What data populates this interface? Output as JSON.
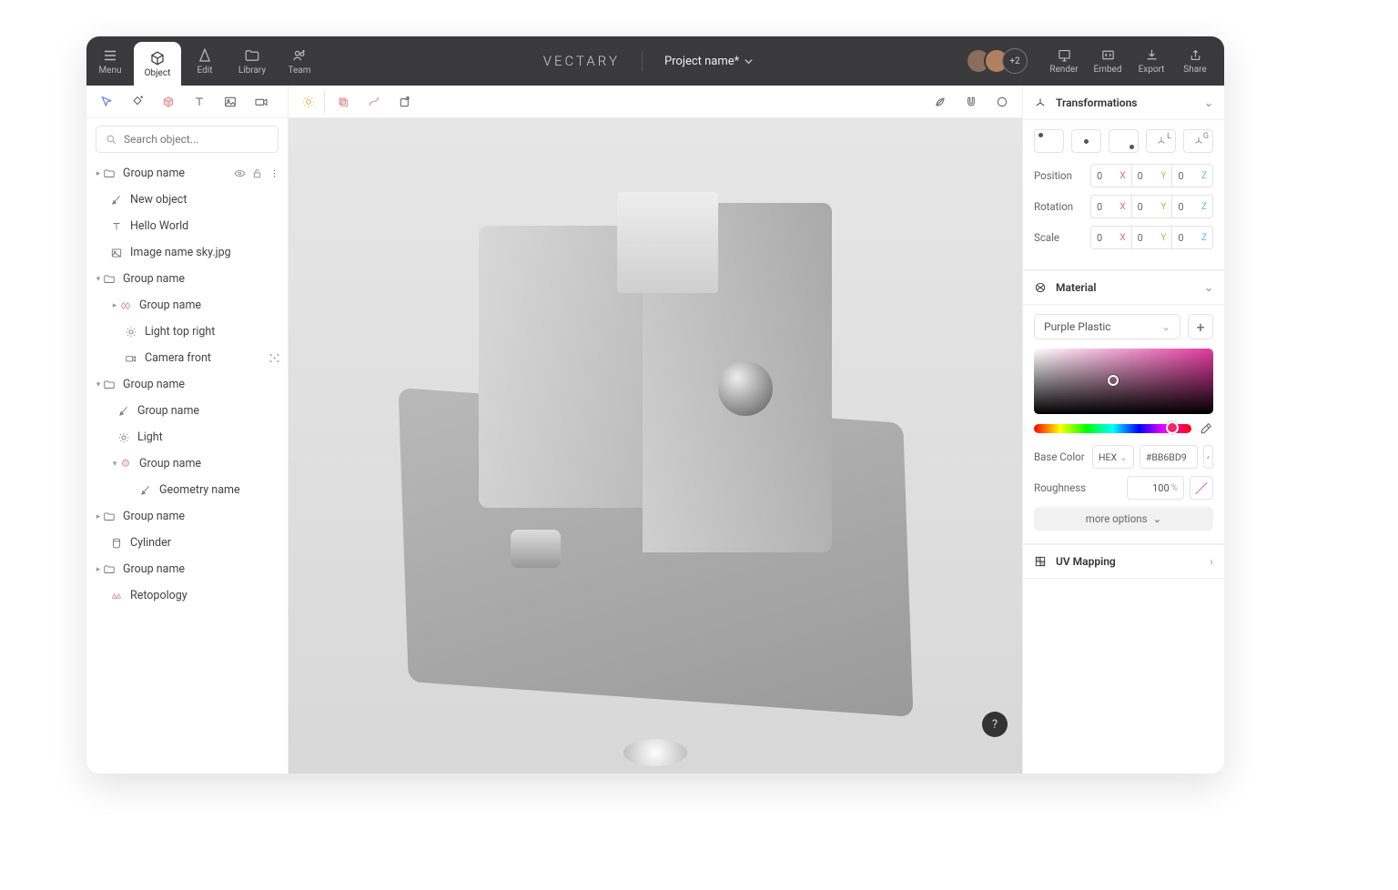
{
  "titlebar": {
    "menu": "Menu",
    "object": "Object",
    "edit": "Edit",
    "library": "Library",
    "team": "Team",
    "logo": "VECTARY",
    "project": "Project name*",
    "avatar_more": "+2",
    "render": "Render",
    "embed": "Embed",
    "export": "Export",
    "share": "Share"
  },
  "search": {
    "placeholder": "Search object..."
  },
  "tree": {
    "n0": "Group name",
    "n1": "New object",
    "n2": "Hello World",
    "n3": "Image name sky.jpg",
    "n4": "Group name",
    "n5": "Group name",
    "n6": "Light top right",
    "n7": "Camera front",
    "n8": "Group name",
    "n9": "Group name",
    "n10": "Light",
    "n11": "Group name",
    "n12": "Geometry name",
    "n13": "Group name",
    "n14": "Cylinder",
    "n15": "Group name",
    "n16": "Retopology"
  },
  "help": "?",
  "panel": {
    "transforms": "Transformations",
    "position": "Position",
    "rotation": "Rotation",
    "scale": "Scale",
    "posx": "0",
    "posy": "0",
    "posz": "0",
    "rotx": "0",
    "roty": "0",
    "rotz": "0",
    "sclx": "0",
    "scly": "0",
    "sclz": "0",
    "localL": "L",
    "globalG": "G",
    "material": "Material",
    "mat_name": "Purple Plastic",
    "basecolor": "Base Color",
    "hex_label": "HEX",
    "hex_value": "#BB6BD9",
    "roughness": "Roughness",
    "rough_val": "100",
    "more": "more options",
    "uv": "UV Mapping"
  }
}
